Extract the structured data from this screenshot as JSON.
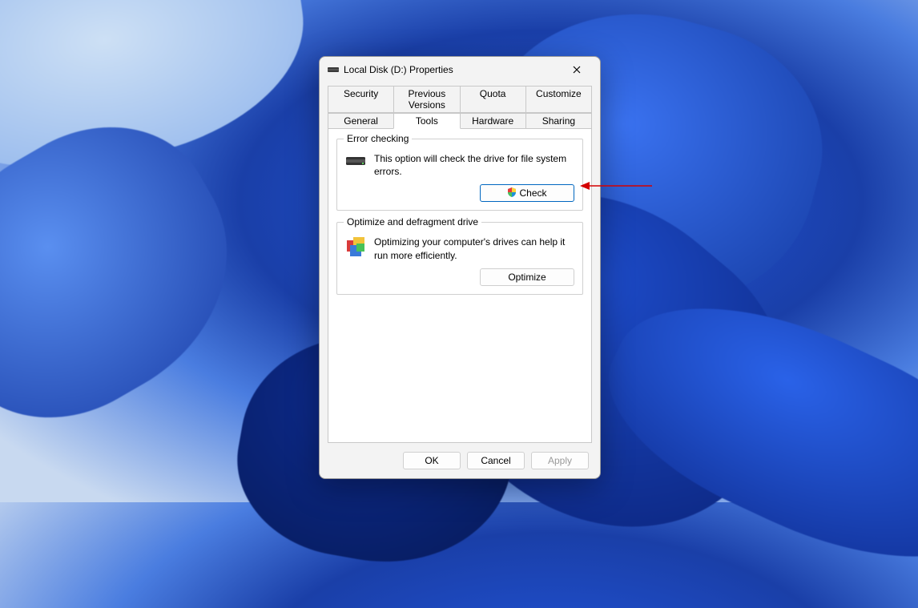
{
  "window": {
    "title": "Local Disk (D:) Properties"
  },
  "tabs": {
    "row1": [
      "Security",
      "Previous Versions",
      "Quota",
      "Customize"
    ],
    "row2": [
      "General",
      "Tools",
      "Hardware",
      "Sharing"
    ],
    "active": "Tools"
  },
  "sections": {
    "errorChecking": {
      "legend": "Error checking",
      "description": "This option will check the drive for file system errors.",
      "button": "Check"
    },
    "optimize": {
      "legend": "Optimize and defragment drive",
      "description": "Optimizing your computer's drives can help it run more efficiently.",
      "button": "Optimize"
    }
  },
  "footer": {
    "ok": "OK",
    "cancel": "Cancel",
    "apply": "Apply"
  }
}
